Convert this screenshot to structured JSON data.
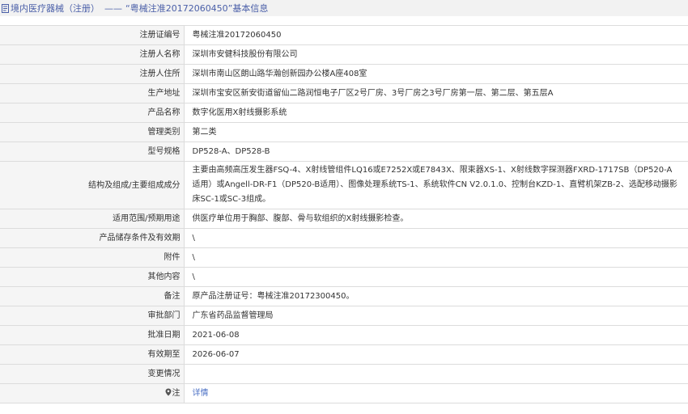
{
  "header": {
    "icon": "document-icon",
    "section": "境内医疗器械（注册）",
    "separator": "——",
    "title": "“粤械注准20172060450”基本信息"
  },
  "rows": [
    {
      "label": "注册证编号",
      "value": "粤械注准20172060450"
    },
    {
      "label": "注册人名称",
      "value": "深圳市安健科技股份有限公司"
    },
    {
      "label": "注册人住所",
      "value": "深圳市南山区朗山路华瀚创新园办公楼A座408室"
    },
    {
      "label": "生产地址",
      "value": "深圳市宝安区新安街道留仙二路润恒电子厂区2号厂房、3号厂房之3号厂房第一层、第二层、第五层A"
    },
    {
      "label": "产品名称",
      "value": "数字化医用X射线摄影系统"
    },
    {
      "label": "管理类别",
      "value": "第二类"
    },
    {
      "label": "型号规格",
      "value": "DP528-A、DP528-B"
    },
    {
      "label": "结构及组成/主要组成成分",
      "value": "主要由高频高压发生器FSQ-4、X射线管组件LQ16或E7252X或E7843X、限束器XS-1、X射线数字探测器FXRD-1717SB（DP520-A适用）或Angell-DR-F1（DP520-B适用）、图像处理系统TS-1、系统软件CN V2.0.1.0、控制台KZD-1、直臂机架ZB-2、选配移动摄影床SC-1或SC-3组成。"
    },
    {
      "label": "适用范围/预期用途",
      "value": "供医疗单位用于胸部、腹部、骨与软组织的X射线摄影检查。"
    },
    {
      "label": "产品储存条件及有效期",
      "value": "\\"
    },
    {
      "label": "附件",
      "value": "\\"
    },
    {
      "label": "其他内容",
      "value": "\\"
    },
    {
      "label": "备注",
      "value": "原产品注册证号：粤械注准20172300450。"
    },
    {
      "label": "审批部门",
      "value": "广东省药品监督管理局"
    },
    {
      "label": "批准日期",
      "value": "2021-06-08"
    },
    {
      "label": "有效期至",
      "value": "2026-06-07"
    },
    {
      "label": "变更情况",
      "value": ""
    }
  ],
  "note": {
    "icon": "map-pin-icon",
    "label": "注",
    "link": "详情"
  }
}
